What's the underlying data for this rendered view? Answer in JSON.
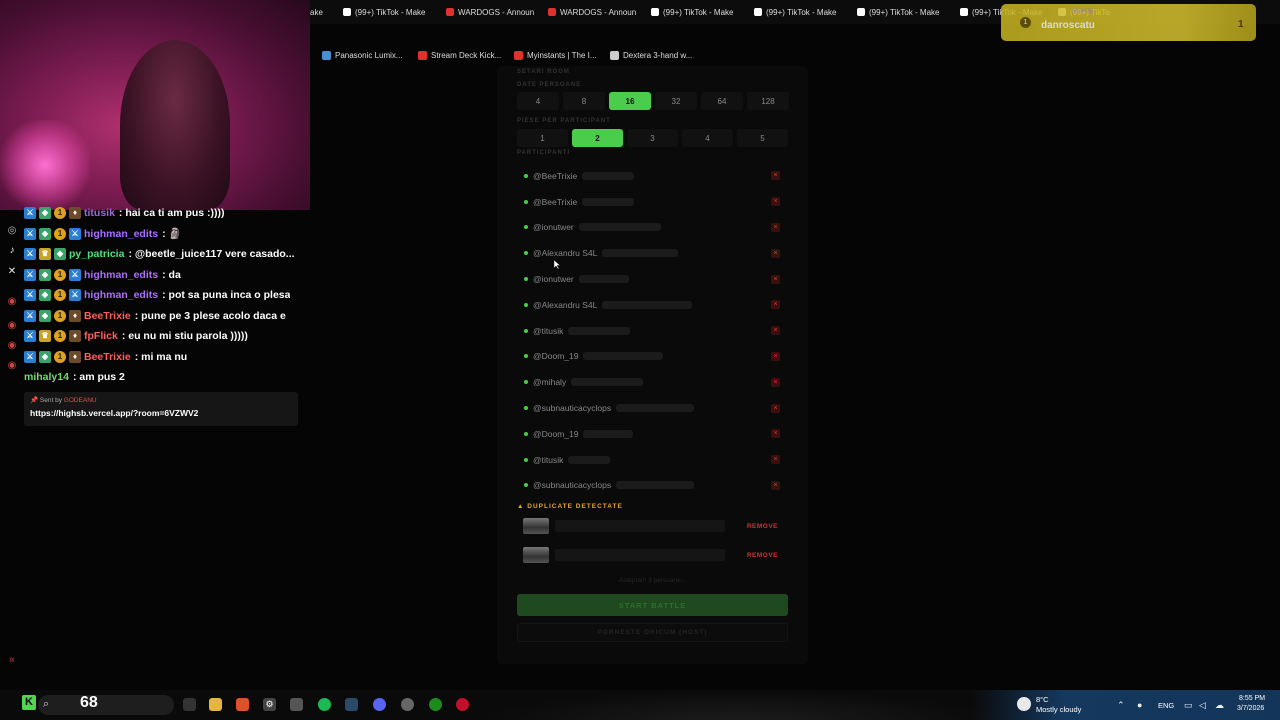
{
  "browser": {
    "tabs": [
      {
        "label": "ake",
        "color": "#999999"
      },
      {
        "label": "(99+) TikTok - Make",
        "color": "#ffffff"
      },
      {
        "label": "WARDOGS - Announ",
        "color": "#e23030"
      },
      {
        "label": "WARDOGS - Announ",
        "color": "#e23030"
      },
      {
        "label": "(99+) TikTok - Make",
        "color": "#ffffff"
      },
      {
        "label": "(99+) TikTok - Make",
        "color": "#ffffff"
      },
      {
        "label": "(99+) TikTok - Make",
        "color": "#ffffff"
      },
      {
        "label": "(99+) TikTok - Make",
        "color": "#ffffff"
      },
      {
        "label": "(99+) TikTo",
        "color": "#ffffff"
      }
    ],
    "bookmarks": [
      {
        "label": "Panasonic Lumix...",
        "color": "#4a8fd4"
      },
      {
        "label": "Stream Deck Kick...",
        "color": "#e23030"
      },
      {
        "label": "Myinstants | The I...",
        "color": "#e23030"
      },
      {
        "label": "Dextera 3-hand w...",
        "color": "#cccccc"
      }
    ]
  },
  "notification": {
    "name": "danroscatu",
    "count": "1",
    "small": "HIGHSB"
  },
  "chat": {
    "messages": [
      {
        "user": "titusik",
        "text": "hai ca ti am pus :))))",
        "color": "#9b6bd6",
        "badges": [
          "b-blue",
          "b-green",
          "b-gold",
          "b-vip"
        ]
      },
      {
        "user": "highman_edits",
        "text": "🗿",
        "color": "#a970ff",
        "badges": [
          "b-blue",
          "b-green",
          "b-gold",
          "b-blue"
        ]
      },
      {
        "user": "py_patricia",
        "text": "@beetle_juice117 vere casado...",
        "color": "#4ee07a",
        "badges": [
          "b-blue",
          "b-crown",
          "b-green"
        ]
      },
      {
        "user": "highman_edits",
        "text": "da",
        "color": "#a970ff",
        "badges": [
          "b-blue",
          "b-green",
          "b-gold",
          "b-blue"
        ]
      },
      {
        "user": "highman_edits",
        "text": "pot sa puna inca o plesa",
        "color": "#a970ff",
        "badges": [
          "b-blue",
          "b-green",
          "b-gold",
          "b-blue"
        ]
      },
      {
        "user": "BeeTrixie",
        "text": "pune pe 3 plese acolo daca e",
        "color": "#ff5f5f",
        "badges": [
          "b-blue",
          "b-green",
          "b-gold",
          "b-vip"
        ]
      },
      {
        "user": "fpFlick",
        "text": "eu nu mi stiu parola )))))",
        "color": "#ff5f5f",
        "badges": [
          "b-blue",
          "b-crown",
          "b-gold",
          "b-vip"
        ]
      },
      {
        "user": "BeeTrixie",
        "text": "mi ma nu",
        "color": "#ff5f5f",
        "badges": [
          "b-blue",
          "b-green",
          "b-gold",
          "b-vip"
        ]
      },
      {
        "user": "mihaly14",
        "text": "am pus 2",
        "color": "#6ddc6d",
        "badges": []
      }
    ],
    "sent_by_label": "Sent by",
    "sent_by_user": "GODEANU",
    "sent_url": "https://highsb.vercel.app/?room=6VZWV2"
  },
  "panel": {
    "room_settings_label": "SETARI ROOM",
    "persons_label": "DATE PERSOANE",
    "persons_options": [
      "4",
      "8",
      "16",
      "32",
      "64",
      "128"
    ],
    "persons_selected": "16",
    "songs_label": "PIESE PER PARTICIPANT",
    "songs_options": [
      "1",
      "2",
      "3",
      "4",
      "5"
    ],
    "songs_selected": "2",
    "participants_label": "PARTICIPANTI",
    "participants": [
      {
        "name": "@BeeTrixie"
      },
      {
        "name": "@BeeTrixie"
      },
      {
        "name": "@ionutwer"
      },
      {
        "name": "@Alexandru S4L"
      },
      {
        "name": "@ionutwer"
      },
      {
        "name": "@Alexandru S4L"
      },
      {
        "name": "@titusik"
      },
      {
        "name": "@Doom_19"
      },
      {
        "name": "@mihaly"
      },
      {
        "name": "@subnauticacyclops"
      },
      {
        "name": "@Doom_19"
      },
      {
        "name": "@titusik"
      },
      {
        "name": "@subnauticacyclops"
      }
    ],
    "remove_glyph": "×",
    "duplicates_title": "DUPLICATE DETECTATE",
    "duplicates": [
      {
        "action": "REMOVE"
      },
      {
        "action": "REMOVE"
      }
    ],
    "waiting_text": "Asteptam 3 persoane...",
    "start_label": "START BATTLE",
    "host_label": "PORNESTE ORICUM (HOST)"
  },
  "taskbar": {
    "k_label": "K",
    "viewer_count": "68",
    "temperature": "8°C",
    "condition": "Mostly cloudy",
    "language": "ENG",
    "time": "8:55 PM",
    "date": "3/7/2026"
  }
}
